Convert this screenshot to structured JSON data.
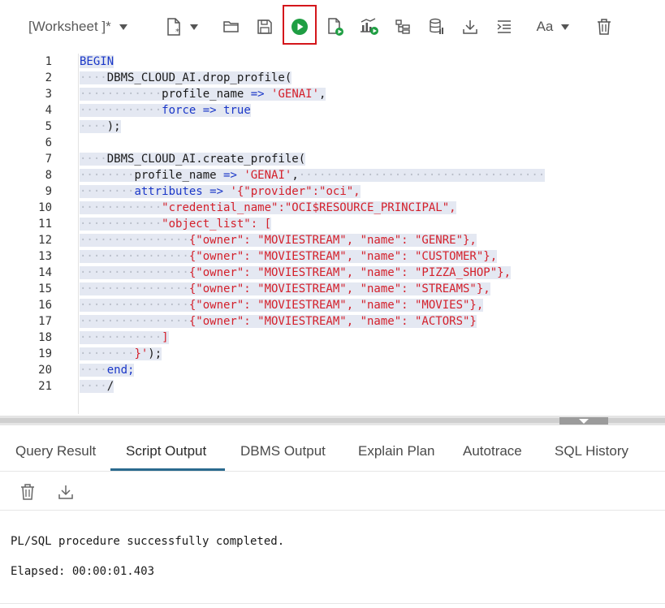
{
  "toolbar": {
    "worksheet_label": "[Worksheet ]*",
    "buttons": [
      {
        "name": "new-worksheet-button",
        "icon": "new-file-icon"
      },
      {
        "name": "open-button",
        "icon": "folder-icon"
      },
      {
        "name": "save-button",
        "icon": "save-icon"
      },
      {
        "name": "run-statement-button",
        "icon": "play-circle-icon"
      },
      {
        "name": "run-script-button",
        "icon": "file-play-icon"
      },
      {
        "name": "explain-plan-button",
        "icon": "chart-play-icon"
      },
      {
        "name": "autotrace-button",
        "icon": "tree-icon"
      },
      {
        "name": "sql-history-button",
        "icon": "database-icon"
      },
      {
        "name": "download-button",
        "icon": "download-icon"
      },
      {
        "name": "format-button",
        "icon": "indent-icon"
      },
      {
        "name": "font-button",
        "icon": "font-icon"
      },
      {
        "name": "clear-button",
        "icon": "trash-icon"
      }
    ],
    "font_label": "Aa"
  },
  "editor": {
    "lines": [
      {
        "n": "1",
        "dots": "",
        "tokens": [
          {
            "t": "BEGIN",
            "c": "kw"
          }
        ]
      },
      {
        "n": "2",
        "dots": "····",
        "tokens": [
          {
            "t": "DBMS_CLOUD_AI.drop_profile(",
            "c": "txt"
          }
        ]
      },
      {
        "n": "3",
        "dots": "············",
        "tokens": [
          {
            "t": "profile_name ",
            "c": "txt"
          },
          {
            "t": "=>",
            "c": "kw"
          },
          {
            "t": " ",
            "c": "txt"
          },
          {
            "t": "'GENAI'",
            "c": "str"
          },
          {
            "t": ",",
            "c": "txt"
          }
        ]
      },
      {
        "n": "4",
        "dots": "············",
        "tokens": [
          {
            "t": "force ",
            "c": "kw"
          },
          {
            "t": "=>",
            "c": "kw"
          },
          {
            "t": " ",
            "c": "txt"
          },
          {
            "t": "true",
            "c": "kw"
          }
        ]
      },
      {
        "n": "5",
        "dots": "····",
        "tokens": [
          {
            "t": ");",
            "c": "txt"
          }
        ]
      },
      {
        "n": "6",
        "dots": "",
        "tokens": []
      },
      {
        "n": "7",
        "dots": "····",
        "tokens": [
          {
            "t": "DBMS_CLOUD_AI.create_profile(",
            "c": "txt"
          }
        ]
      },
      {
        "n": "8",
        "dots": "········",
        "tokens": [
          {
            "t": "profile_name ",
            "c": "txt"
          },
          {
            "t": "=>",
            "c": "kw"
          },
          {
            "t": " ",
            "c": "txt"
          },
          {
            "t": "'GENAI'",
            "c": "str"
          },
          {
            "t": ",",
            "c": "txt"
          }
        ]
      },
      {
        "n": "9",
        "dots": "········",
        "tokens": [
          {
            "t": "attributes ",
            "c": "kw"
          },
          {
            "t": "=>",
            "c": "kw"
          },
          {
            "t": " ",
            "c": "txt"
          },
          {
            "t": "'{\"provider\":\"oci\",",
            "c": "str"
          }
        ]
      },
      {
        "n": "10",
        "dots": "············",
        "tokens": [
          {
            "t": "\"credential_name\":\"OCI$RESOURCE_PRINCIPAL\",",
            "c": "str"
          }
        ]
      },
      {
        "n": "11",
        "dots": "············",
        "tokens": [
          {
            "t": "\"object_list\": [",
            "c": "str"
          }
        ]
      },
      {
        "n": "12",
        "dots": "················",
        "tokens": [
          {
            "t": "{\"owner\": \"MOVIESTREAM\", \"name\": \"GENRE\"},",
            "c": "str"
          }
        ]
      },
      {
        "n": "13",
        "dots": "················",
        "tokens": [
          {
            "t": "{\"owner\": \"MOVIESTREAM\", \"name\": \"CUSTOMER\"},",
            "c": "str"
          }
        ]
      },
      {
        "n": "14",
        "dots": "················",
        "tokens": [
          {
            "t": "{\"owner\": \"MOVIESTREAM\", \"name\": \"PIZZA_SHOP\"},",
            "c": "str"
          }
        ]
      },
      {
        "n": "15",
        "dots": "················",
        "tokens": [
          {
            "t": "{\"owner\": \"MOVIESTREAM\", \"name\": \"STREAMS\"},",
            "c": "str"
          }
        ]
      },
      {
        "n": "16",
        "dots": "················",
        "tokens": [
          {
            "t": "{\"owner\": \"MOVIESTREAM\", \"name\": \"MOVIES\"},",
            "c": "str"
          }
        ]
      },
      {
        "n": "17",
        "dots": "················",
        "tokens": [
          {
            "t": "{\"owner\": \"MOVIESTREAM\", \"name\": \"ACTORS\"}",
            "c": "str"
          }
        ]
      },
      {
        "n": "18",
        "dots": "············",
        "tokens": [
          {
            "t": "]",
            "c": "str"
          }
        ]
      },
      {
        "n": "19",
        "dots": "········",
        "tokens": [
          {
            "t": "}'",
            "c": "str"
          },
          {
            "t": ");",
            "c": "txt"
          }
        ]
      },
      {
        "n": "20",
        "dots": "····",
        "tokens": [
          {
            "t": "end;",
            "c": "kw"
          }
        ]
      },
      {
        "n": "21",
        "dots": "····",
        "tokens": [
          {
            "t": "/",
            "c": "txt"
          }
        ]
      }
    ]
  },
  "tabs": [
    {
      "label": "Query Result",
      "name": "tab-query-result"
    },
    {
      "label": "Script Output",
      "name": "tab-script-output"
    },
    {
      "label": "DBMS Output",
      "name": "tab-dbms-output"
    },
    {
      "label": "Explain Plan",
      "name": "tab-explain-plan"
    },
    {
      "label": "Autotrace",
      "name": "tab-autotrace"
    },
    {
      "label": "SQL History",
      "name": "tab-sql-history"
    }
  ],
  "active_tab": "Script Output",
  "output": {
    "message": "PL/SQL procedure successfully completed.",
    "elapsed": "Elapsed: 00:00:01.403"
  },
  "colors": {
    "keyword": "#1a37c8",
    "string": "#d4202b",
    "run_green": "#1f9e43",
    "highlight_border": "#d4161b",
    "selection": "#e4e8f2",
    "active_tab_underline": "#2b6a8e"
  }
}
